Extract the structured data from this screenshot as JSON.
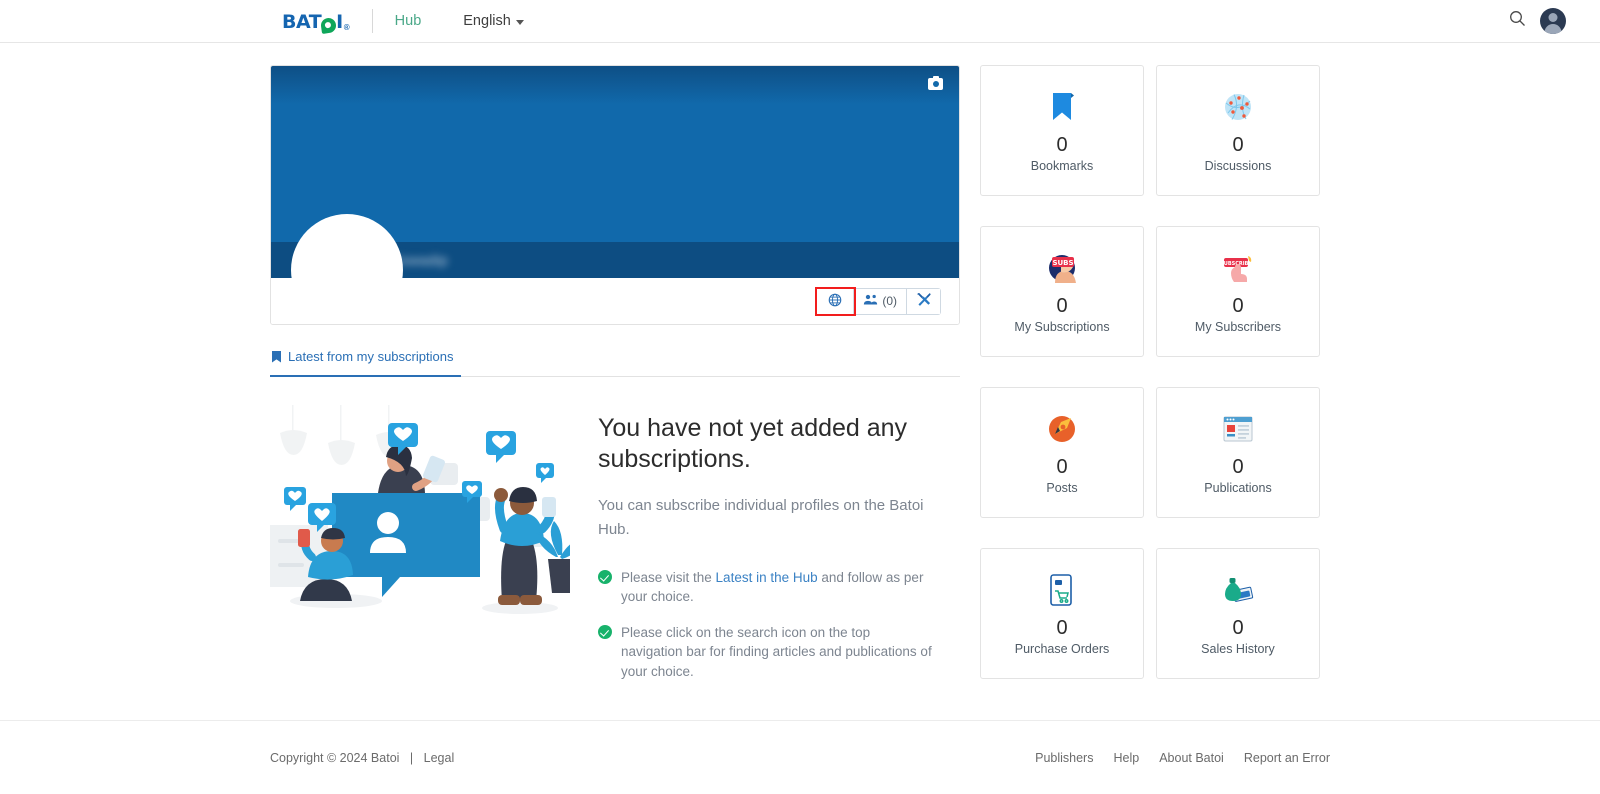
{
  "nav": {
    "logo_text_1": "BAT",
    "logo_text_2": "I",
    "logo_reg": "®",
    "hub_label": "Hub",
    "language_label": "English",
    "search_icon": "search-icon",
    "avatar_icon": "user-avatar-icon"
  },
  "profile": {
    "camera_icon": "camera-icon",
    "name_blurred": "Biswadip",
    "actions": [
      {
        "icon": "globe-icon",
        "label": "",
        "highlighted": true
      },
      {
        "icon": "people-icon",
        "label": "(0)",
        "highlighted": false
      },
      {
        "icon": "tools-icon",
        "label": "",
        "highlighted": false
      }
    ]
  },
  "tabs": [
    {
      "icon": "bookmark-icon",
      "label": "Latest from my subscriptions",
      "active": true
    }
  ],
  "empty_state": {
    "illustration": "social-media-subscriptions-illustration",
    "heading": "You have not yet added any subscriptions.",
    "paragraph": "You can subscribe individual profiles on the Batoi Hub.",
    "hints": [
      {
        "icon": "check-circle-icon",
        "before": "Please visit the ",
        "link": "Latest in the Hub",
        "after": " and follow as per your choice."
      },
      {
        "icon": "check-circle-icon",
        "before": "Please click on the search icon on the top navigation bar for finding articles and publications of your choice.",
        "link": "",
        "after": ""
      }
    ]
  },
  "stats": [
    {
      "icon": "bookmark-icon",
      "value": "0",
      "label": "Bookmarks"
    },
    {
      "icon": "discussions-network-icon",
      "value": "0",
      "label": "Discussions"
    },
    {
      "icon": "subscriptions-icon",
      "value": "0",
      "label": "My Subscriptions"
    },
    {
      "icon": "subscribers-icon",
      "value": "0",
      "label": "My Subscribers"
    },
    {
      "icon": "posts-pen-icon",
      "value": "0",
      "label": "Posts"
    },
    {
      "icon": "publications-window-icon",
      "value": "0",
      "label": "Publications"
    },
    {
      "icon": "purchase-orders-icon",
      "value": "0",
      "label": "Purchase Orders"
    },
    {
      "icon": "sales-history-moneybag-icon",
      "value": "0",
      "label": "Sales History"
    }
  ],
  "footer": {
    "copyright": "Copyright © 2024 Batoi",
    "separator": "|",
    "legal": "Legal",
    "links": [
      "Publishers",
      "Help",
      "About Batoi",
      "Report an Error"
    ]
  },
  "colors": {
    "brand_blue": "#1565b0",
    "brand_green": "#0fa65a",
    "banner_blue": "#1169ab",
    "banner_dark": "#0d4d82",
    "link_blue": "#2a6fb5",
    "highlight_red": "#f21d1d",
    "check_green": "#18b26b"
  }
}
